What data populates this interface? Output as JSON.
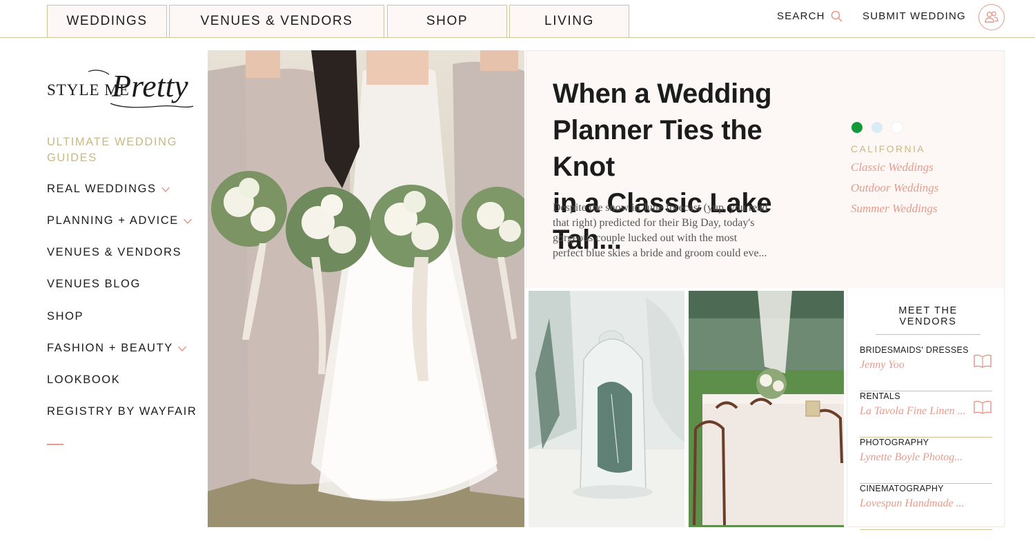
{
  "nav": {
    "tabs": [
      "WEDDINGS",
      "VENUES & VENDORS",
      "SHOP",
      "LIVING"
    ],
    "search_label": "SEARCH",
    "submit_label": "SUBMIT WEDDING"
  },
  "brand": {
    "logo_text_left": "STYLE ME",
    "logo_text_script": "Pretty"
  },
  "sidebar": {
    "items": [
      {
        "label": "ULTIMATE WEDDING GUIDES",
        "line1": "ULTIMATE WEDDING",
        "line2": "GUIDES",
        "has_dropdown": false,
        "highlight": true
      },
      {
        "label": "REAL WEDDINGS",
        "has_dropdown": true
      },
      {
        "label": "PLANNING + ADVICE",
        "has_dropdown": true
      },
      {
        "label": "VENUES & VENDORS",
        "has_dropdown": false
      },
      {
        "label": "VENUES BLOG",
        "has_dropdown": false
      },
      {
        "label": "SHOP",
        "has_dropdown": false
      },
      {
        "label": "FASHION + BEAUTY",
        "has_dropdown": true
      },
      {
        "label": "LOOKBOOK",
        "has_dropdown": false
      },
      {
        "label": "REGISTRY BY WAYFAIR",
        "has_dropdown": false
      }
    ]
  },
  "feature": {
    "headline_l1": "When a Wedding",
    "headline_l2": "Planner Ties the Knot",
    "headline_l3": "in a Classic Lake Tah...",
    "excerpt_l1": "Despite the snow in June forecast (yup, you read",
    "excerpt_l2": "that right) predicted for their Big Day,  today's",
    "excerpt_l3": "gorgeous couple lucked out with the most",
    "excerpt_l4": "perfect blue skies a bride and groom could eve...",
    "color_dots": [
      "#119a3a",
      "#d9ebf5",
      "#ffffff"
    ],
    "location": "CALIFORNIA",
    "tags": [
      "Classic Weddings",
      "Outdoor Weddings",
      "Summer Weddings"
    ]
  },
  "vendors": {
    "title": "MEET THE VENDORS",
    "items": [
      {
        "category": "BRIDESMAIDS' DRESSES",
        "name": "Jenny Yoo",
        "icon": "lookbook-icon"
      },
      {
        "category": "RENTALS",
        "name": "La Tavola Fine Linen ...",
        "icon": "lookbook-icon"
      },
      {
        "category": "PHOTOGRAPHY",
        "name": "Lynette Boyle Photog...",
        "icon": null
      },
      {
        "category": "CINEMATOGRAPHY",
        "name": "Lovespun Handmade ...",
        "icon": null
      }
    ]
  },
  "colors": {
    "gold": "#cfc39a",
    "gold_text": "#c9b883",
    "coral": "#e59b8c",
    "panel_bg": "#fdf8f6"
  }
}
